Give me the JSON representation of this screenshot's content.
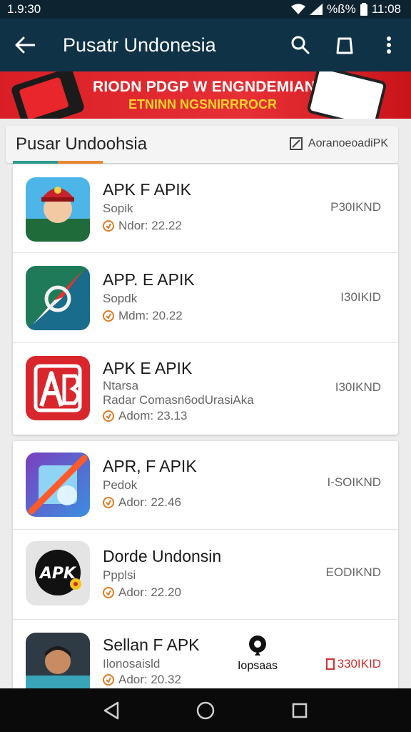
{
  "status_bar": {
    "time": "1.9:30",
    "battery_percent": "%ß%",
    "clock": "11:08"
  },
  "app_bar": {
    "title": "Pusatr Undonesia"
  },
  "banner": {
    "line1": "RIODN PDGP W ENGNDEMIAN",
    "line2": "ETNINN NGSNIRRROCR"
  },
  "section": {
    "title": "Pusar Undoohsia",
    "link_label": "AoranoeoadiPK"
  },
  "apps": [
    {
      "name": "APK F APIK",
      "subtitle": "Sopik",
      "date": "Ndor: 22.22",
      "size": "P30IKND",
      "icon": "mascot-icon"
    },
    {
      "name": "APP. E APIK",
      "subtitle": "Sopdk",
      "date": "Mdm: 20.22",
      "size": "I30IKID",
      "icon": "compass-icon"
    },
    {
      "name": "APK E APIK",
      "subtitle": "Ntarsa",
      "extra": "Radar Comasn6odUrasiAka",
      "date": "Adom: 23.13",
      "size": "I30IKND",
      "icon": "ab-icon"
    },
    {
      "name": "APR, F APIK",
      "subtitle": "Pedok",
      "date": "Ador: 22.46",
      "size": "I-SOIKND",
      "icon": "blocked-photo-icon"
    },
    {
      "name": "Dorde Undonsin",
      "subtitle": "Ppplsi",
      "date": "Ador: 22.20",
      "size": "EODIKND",
      "icon": "apk-badge-icon"
    },
    {
      "name": "Sellan F APK",
      "subtitle": "Ilonosaisld",
      "date": "Ador: 20.32",
      "size": "330IKID",
      "action_label": "Iopsaas",
      "icon": "person-photo"
    }
  ],
  "colors": {
    "app_bar": "#0f3247",
    "banner": "#e02a2f",
    "accent_red": "#d32f2f"
  }
}
